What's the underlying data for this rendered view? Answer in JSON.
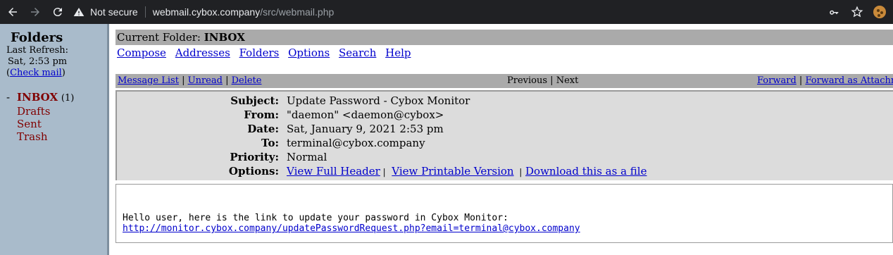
{
  "browser": {
    "security_label": "Not secure",
    "url_host": "webmail.cybox.company",
    "url_path": "/src/webmail.php"
  },
  "left": {
    "folders_title": "Folders",
    "last_refresh_label": "Last Refresh:",
    "last_refresh_time": "Sat, 2:53 pm",
    "check_mail_open": "(",
    "check_mail": "Check mail",
    "check_mail_close": ")",
    "folders": [
      {
        "name": "INBOX",
        "count": "(1)"
      },
      {
        "name": "Drafts"
      },
      {
        "name": "Sent"
      },
      {
        "name": "Trash"
      }
    ]
  },
  "main": {
    "current_folder_label": "Current Folder:",
    "current_folder": "INBOX",
    "nav": [
      "Compose",
      "Addresses",
      "Folders",
      "Options",
      "Search",
      "Help"
    ],
    "msgbar": {
      "message_list": "Message List",
      "unread": "Unread",
      "delete": "Delete",
      "previous": "Previous",
      "next": "Next",
      "forward": "Forward",
      "forward_attachment": "Forward as Attachment",
      "sep": "|"
    },
    "headers": {
      "subject_label": "Subject:",
      "subject": "Update Password - Cybox Monitor",
      "from_label": "From:",
      "from": "\"daemon\" <daemon@cybox>",
      "date_label": "Date:",
      "date": "Sat, January 9, 2021 2:53 pm",
      "to_label": "To:",
      "to": "terminal@cybox.company",
      "priority_label": "Priority:",
      "priority": "Normal",
      "options_label": "Options:",
      "view_full_header": "View Full Header",
      "view_printable": "View Printable Version",
      "download": "Download this as a file"
    },
    "body": {
      "line1": "Hello user, here is the link to update your password in Cybox Monitor:",
      "link": "http://monitor.cybox.company/updatePasswordRequest.php?email=terminal@cybox.company"
    }
  }
}
